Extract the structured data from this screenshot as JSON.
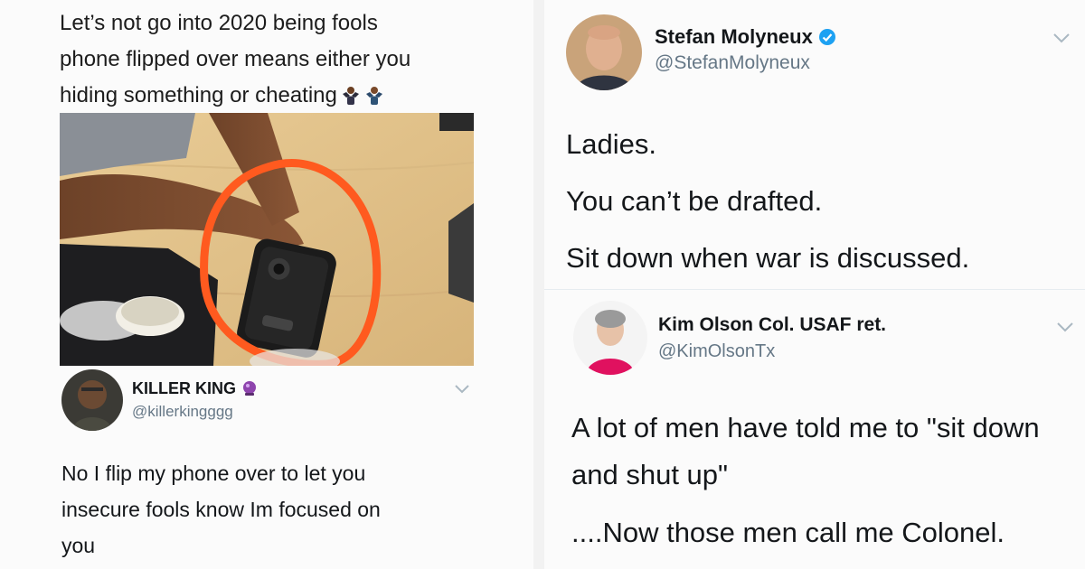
{
  "left": {
    "top_tweet": {
      "lines": [
        "Let’s not go into 2020 being fools",
        "phone flipped over means either you",
        "hiding something or cheating"
      ],
      "emojis": [
        "person-shrugging-emoji",
        "person-shrugging-emoji"
      ]
    },
    "photo": {
      "icon": "phone-on-table-photo",
      "circle_color": "#ff5a1f"
    },
    "reply_tweet": {
      "name": "KILLER KING",
      "badge": "crystal-ball-emoji",
      "handle": "@killerkingggg",
      "lines": [
        "No I flip my phone over to let you",
        "insecure fools know Im focused on",
        "you"
      ]
    }
  },
  "right": {
    "top_tweet": {
      "name": "Stefan Molyneux",
      "verified": true,
      "handle": "@StefanMolyneux",
      "lines": [
        "Ladies.",
        "You can’t be drafted.",
        "Sit down when war is discussed."
      ]
    },
    "reply_tweet": {
      "name": "Kim Olson Col. USAF ret.",
      "handle": "@KimOlsonTx",
      "lines": [
        "A lot of men have told me to \"sit down",
        "and shut up\"",
        "....Now those men call me Colonel."
      ]
    }
  },
  "colors": {
    "verified": "#1da1f2",
    "chevron": "#aab8c2",
    "handle": "#657786"
  }
}
